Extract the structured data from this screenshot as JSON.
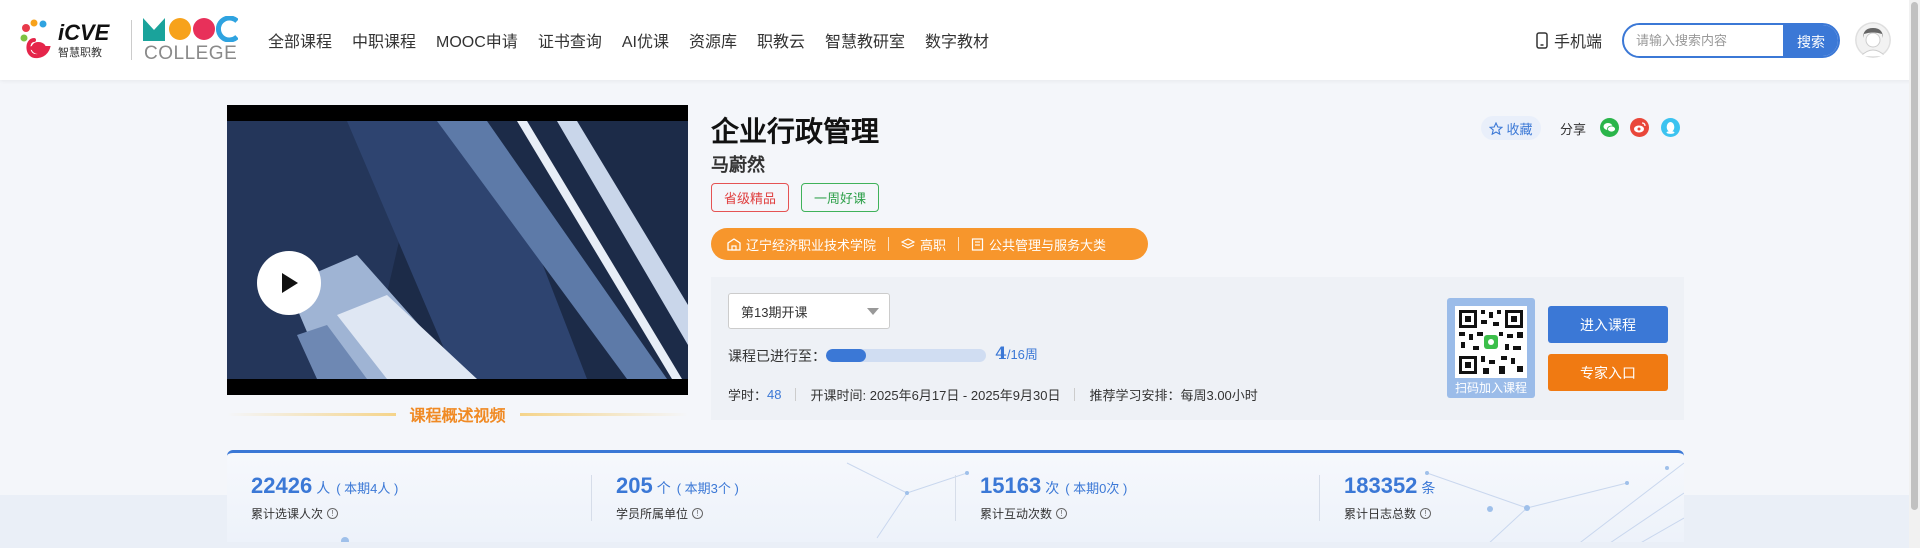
{
  "header": {
    "logo_icve_text": "iCVE",
    "logo_icve_sub": "智慧职教",
    "logo_mooc_text": "MOOC",
    "logo_college_text": "COLLEGE",
    "nav": [
      {
        "label": "全部课程"
      },
      {
        "label": "中职课程"
      },
      {
        "label": "MOOC申请"
      },
      {
        "label": "证书查询"
      },
      {
        "label": "AI优课"
      },
      {
        "label": "资源库"
      },
      {
        "label": "职教云"
      },
      {
        "label": "智慧教研室"
      },
      {
        "label": "数字教材"
      }
    ],
    "mobile_label": "手机端",
    "search_placeholder": "请输入搜索内容",
    "search_button": "搜索"
  },
  "course": {
    "title": "企业行政管理",
    "teacher": "马蔚然",
    "tags": [
      "省级精品",
      "一周好课"
    ],
    "school": "辽宁经济职业技术学院",
    "level": "高职",
    "category": "公共管理与服务大类",
    "video_caption": "课程概述视频",
    "favorite_label": "收藏",
    "share_label": "分享",
    "term": "第13期开课",
    "progress_label": "课程已进行至：",
    "progress_current": "4",
    "progress_total": "/16周",
    "progress_fraction": 0.25,
    "hours_label": "学时：",
    "hours_value": "48",
    "dates": "开课时间: 2025年6月17日 - 2025年9月30日",
    "schedule": "推荐学习安排：每周3.00小时",
    "qr_label": "扫码加入课程",
    "enter_button": "进入课程",
    "expert_button": "专家入口"
  },
  "stats": [
    {
      "num": "22426",
      "unit": "人",
      "sub": "( 本期4人 )",
      "label": "累计选课人次"
    },
    {
      "num": "205",
      "unit": "个",
      "sub": "( 本期3个 )",
      "label": "学员所属单位"
    },
    {
      "num": "15163",
      "unit": "次",
      "sub": "( 本期0次 )",
      "label": "累计互动次数"
    },
    {
      "num": "183352",
      "unit": "条",
      "sub": "",
      "label": "累计日志总数"
    }
  ],
  "colors": {
    "primary_blue": "#3b78d6",
    "orange": "#f7962c",
    "expert_orange": "#f07a12",
    "tag_red": "#e04040",
    "tag_green": "#2ea04a"
  }
}
